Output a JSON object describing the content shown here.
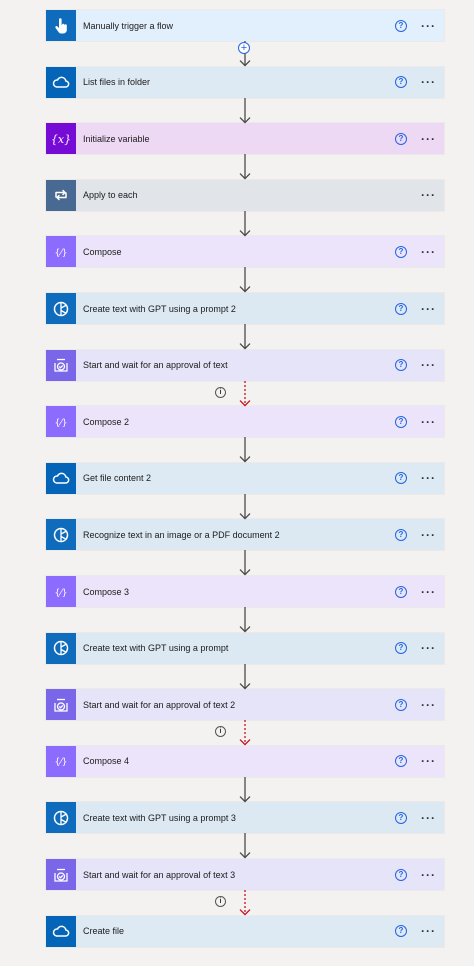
{
  "steps": [
    {
      "title": "Manually trigger a flow",
      "icon": "trigger-hand-icon",
      "bg": "#e2effd",
      "icon_bg": "#0f6cbd",
      "help": true
    },
    {
      "title": "List files in folder",
      "icon": "onedrive-cloud-icon",
      "bg": "#dde9f3",
      "icon_bg": "#0364b8",
      "help": true
    },
    {
      "title": "Initialize variable",
      "icon": "variable-icon",
      "bg": "#eed9f5",
      "icon_bg": "#770bd6",
      "help": true
    },
    {
      "title": "Apply to each",
      "icon": "loop-icon",
      "bg": "#e1e5ea",
      "icon_bg": "#486991",
      "help": false
    },
    {
      "title": "Compose",
      "icon": "compose-icon",
      "bg": "#ebe4fb",
      "icon_bg": "#8c6cff",
      "help": true
    },
    {
      "title": "Create text with GPT using a prompt 2",
      "icon": "ai-builder-icon",
      "bg": "#dce9f3",
      "icon_bg": "#0f6cbd",
      "help": true
    },
    {
      "title": "Start and wait for an approval of text",
      "icon": "approval-icon",
      "bg": "#e6e4f8",
      "icon_bg": "#7a66e8",
      "help": true
    },
    {
      "title": "Compose 2",
      "icon": "compose-icon",
      "bg": "#ebe4fb",
      "icon_bg": "#8c6cff",
      "help": true
    },
    {
      "title": "Get file content 2",
      "icon": "onedrive-cloud-icon",
      "bg": "#dde9f3",
      "icon_bg": "#0364b8",
      "help": true
    },
    {
      "title": "Recognize text in an image or a PDF document 2",
      "icon": "ai-builder-icon",
      "bg": "#dce9f3",
      "icon_bg": "#0f6cbd",
      "help": true
    },
    {
      "title": "Compose 3",
      "icon": "compose-icon",
      "bg": "#ebe4fb",
      "icon_bg": "#8c6cff",
      "help": true
    },
    {
      "title": "Create text with GPT using a prompt",
      "icon": "ai-builder-icon",
      "bg": "#dce9f3",
      "icon_bg": "#0f6cbd",
      "help": true
    },
    {
      "title": "Start and wait for an approval of text 2",
      "icon": "approval-icon",
      "bg": "#e6e4f8",
      "icon_bg": "#7a66e8",
      "help": true
    },
    {
      "title": "Compose 4",
      "icon": "compose-icon",
      "bg": "#ebe4fb",
      "icon_bg": "#8c6cff",
      "help": true
    },
    {
      "title": "Create text with GPT using a prompt 3",
      "icon": "ai-builder-icon",
      "bg": "#dce9f3",
      "icon_bg": "#0f6cbd",
      "help": true
    },
    {
      "title": "Start and wait for an approval of text 3",
      "icon": "approval-icon",
      "bg": "#e6e4f8",
      "icon_bg": "#7a66e8",
      "help": true
    },
    {
      "title": "Create file",
      "icon": "onedrive-cloud-icon",
      "bg": "#dde9f3",
      "icon_bg": "#0364b8",
      "help": true
    }
  ],
  "connectors": [
    {
      "kind": "plus"
    },
    {
      "kind": "normal"
    },
    {
      "kind": "normal"
    },
    {
      "kind": "normal"
    },
    {
      "kind": "normal"
    },
    {
      "kind": "normal"
    },
    {
      "kind": "run-after"
    },
    {
      "kind": "normal"
    },
    {
      "kind": "normal"
    },
    {
      "kind": "normal"
    },
    {
      "kind": "normal"
    },
    {
      "kind": "normal"
    },
    {
      "kind": "run-after"
    },
    {
      "kind": "normal"
    },
    {
      "kind": "normal"
    },
    {
      "kind": "run-after"
    }
  ],
  "labels": {
    "help": "?",
    "more": "···",
    "info": "i",
    "plus": "+"
  },
  "colors": {
    "arrow": "#4a4a4a",
    "run_after": "#c50f1f",
    "link": "#2266e3"
  }
}
